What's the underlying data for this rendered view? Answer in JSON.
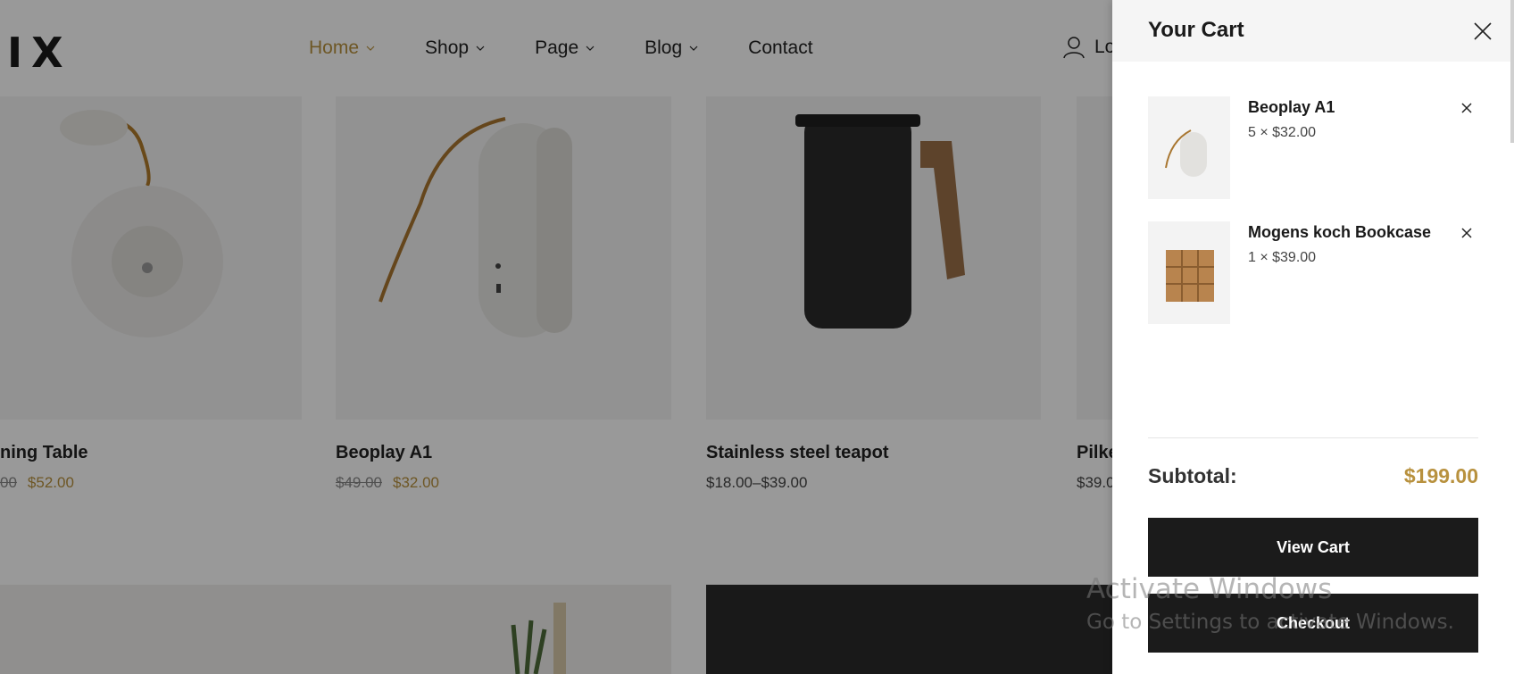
{
  "header": {
    "logo": "IX",
    "nav": [
      {
        "label": "Home",
        "active": true
      },
      {
        "label": "Shop"
      },
      {
        "label": "Page"
      },
      {
        "label": "Blog"
      },
      {
        "label": "Contact"
      }
    ],
    "login_label": "Lo"
  },
  "products": [
    {
      "name": "ning Table",
      "old_price": "00",
      "price": "$52.00"
    },
    {
      "name": "Beoplay A1",
      "old_price": "$49.00",
      "price": "$32.00"
    },
    {
      "name": "Stainless steel teapot",
      "price_range": "$18.00–$39.00"
    },
    {
      "name": "Pilke",
      "price_range": "$39.0"
    }
  ],
  "cart": {
    "title": "Your Cart",
    "items": [
      {
        "name": "Beoplay A1",
        "qty_price": "5 × $32.00"
      },
      {
        "name": "Mogens koch Bookcase",
        "qty_price": "1 × $39.00"
      }
    ],
    "subtotal_label": "Subtotal:",
    "subtotal_value": "$199.00",
    "view_cart": "View Cart",
    "checkout": "Checkout"
  },
  "watermark": {
    "line1": "Activate Windows",
    "line2": "Go to Settings to activate Windows."
  },
  "colors": {
    "accent": "#b8913e",
    "button": "#1b1b1b"
  }
}
